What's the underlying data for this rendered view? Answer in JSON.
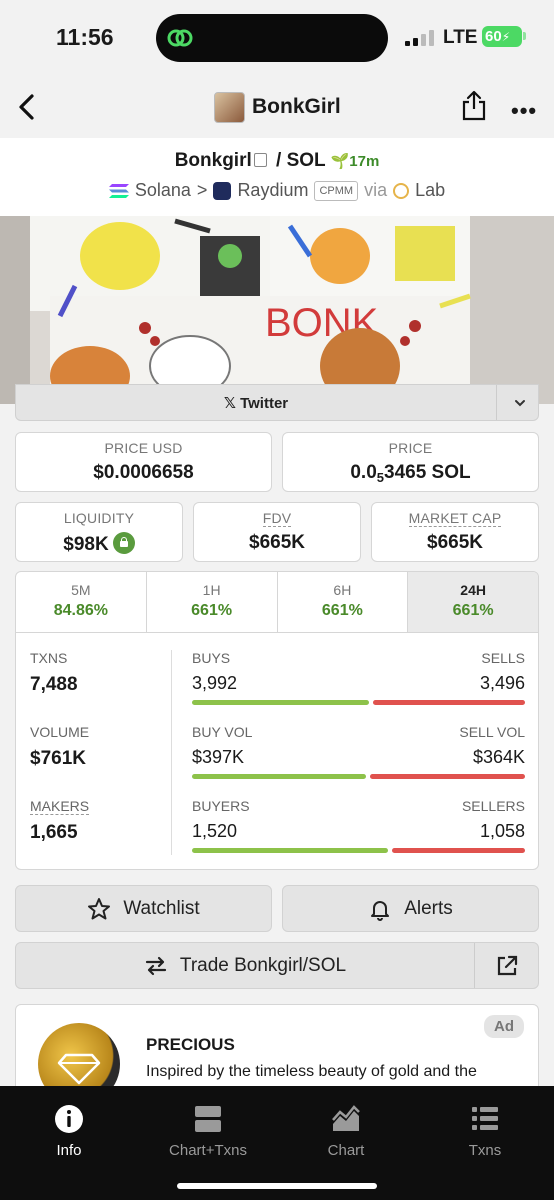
{
  "status_bar": {
    "time": "11:56",
    "network": "LTE",
    "battery": "60"
  },
  "nav": {
    "title": "BonkGirl"
  },
  "pair": {
    "base": "Bonkgirl",
    "separator": "/",
    "quote": "SOL",
    "age": "17m",
    "chain": "Solana",
    "chevron": ">",
    "dex": "Raydium",
    "pool_type": "CPMM",
    "via": "via",
    "launchpad": "Lab"
  },
  "banner": {
    "text": "BONK"
  },
  "socials": {
    "twitter_label": "Twitter"
  },
  "stats": {
    "price_usd": {
      "label": "PRICE USD",
      "value": "$0.0006658"
    },
    "price_native": {
      "label": "PRICE",
      "prefix": "0.0",
      "subscript": "5",
      "suffix": "3465 SOL"
    },
    "liquidity": {
      "label": "LIQUIDITY",
      "value": "$98K"
    },
    "fdv": {
      "label": "FDV",
      "value": "$665K"
    },
    "market_cap": {
      "label": "MARKET CAP",
      "value": "$665K"
    }
  },
  "periods": [
    {
      "label": "5M",
      "value": "84.86%"
    },
    {
      "label": "1H",
      "value": "661%"
    },
    {
      "label": "6H",
      "value": "661%"
    },
    {
      "label": "24H",
      "value": "661%"
    }
  ],
  "txn_stats": {
    "txns": {
      "label": "TXNS",
      "value": "7,488"
    },
    "volume": {
      "label": "VOLUME",
      "value": "$761K"
    },
    "makers": {
      "label": "MAKERS",
      "value": "1,665"
    },
    "buys": {
      "label": "BUYS",
      "value": "3,992",
      "ratio": 0.533
    },
    "sells": {
      "label": "SELLS",
      "value": "3,496"
    },
    "buy_vol": {
      "label": "BUY VOL",
      "value": "$397K",
      "ratio": 0.522
    },
    "sell_vol": {
      "label": "SELL VOL",
      "value": "$364K"
    },
    "buyers": {
      "label": "BUYERS",
      "value": "1,520",
      "ratio": 0.59
    },
    "sellers": {
      "label": "SELLERS",
      "value": "1,058"
    }
  },
  "actions": {
    "watchlist": "Watchlist",
    "alerts": "Alerts",
    "trade": "Trade Bonkgirl/SOL"
  },
  "ad": {
    "badge": "Ad",
    "title": "PRECIOUS",
    "text": "Inspired by the timeless beauty of gold and the"
  },
  "bottom_nav": [
    {
      "label": "Info"
    },
    {
      "label": "Chart+Txns"
    },
    {
      "label": "Chart"
    },
    {
      "label": "Txns"
    }
  ],
  "colors": {
    "positive": "#4a8a2a",
    "buy_bar": "#8dc24a",
    "sell_bar": "#e0524e"
  }
}
